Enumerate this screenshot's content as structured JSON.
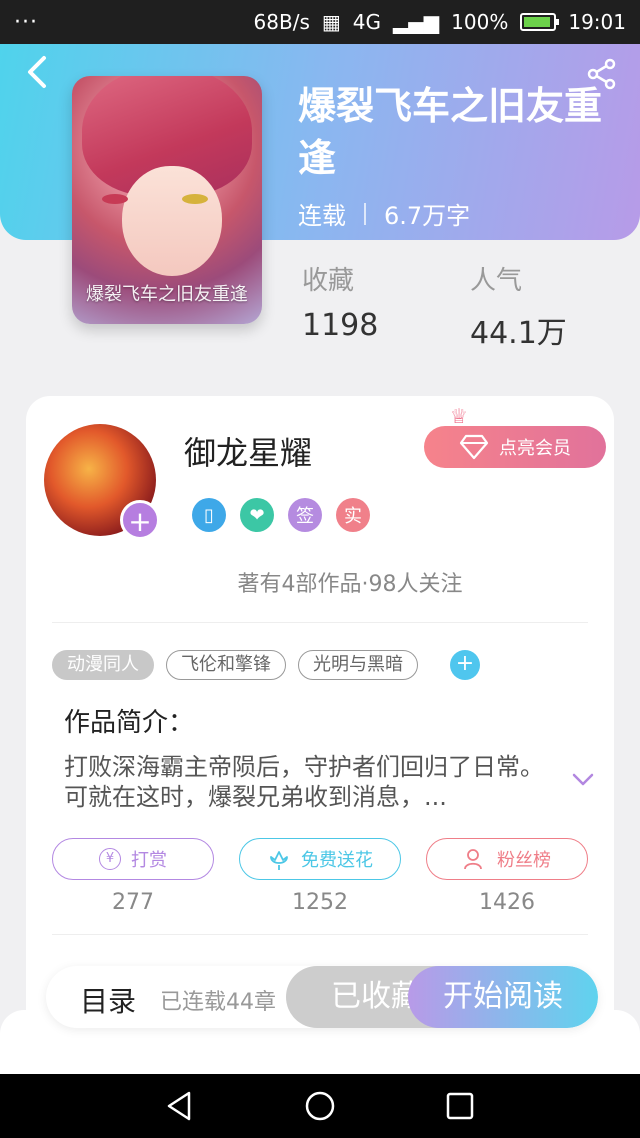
{
  "status": {
    "dots": "···",
    "speed": "68B/s",
    "network": "4G",
    "battery": "100%",
    "time": "19:01"
  },
  "book": {
    "title": "爆裂飞车之旧友重逢",
    "cover_caption": "爆裂飞车之旧友重逢",
    "status": "连载",
    "word_count": "6.7万字",
    "favorites_label": "收藏",
    "favorites_value": "1198",
    "popularity_label": "人气",
    "popularity_value": "44.1万"
  },
  "author": {
    "name": "御龙星耀",
    "vip_label": "点亮会员",
    "badges": [
      {
        "icon": "phone-icon",
        "text": "",
        "color": "#3ea8e8"
      },
      {
        "icon": "handshake-icon",
        "text": "",
        "color": "#3cc7a5"
      },
      {
        "icon": "sign-icon",
        "text": "签",
        "color": "#b58be0"
      },
      {
        "icon": "verified-icon",
        "text": "实",
        "color": "#f0808a"
      }
    ],
    "works_info": "著有4部作品·98人关注"
  },
  "tags": [
    "动漫同人",
    "飞伦和擎锋",
    "光明与黑暗"
  ],
  "intro": {
    "heading": "作品简介：",
    "text": "打败深海霸主帝陨后，守护者们回归了日常。可就在这时，爆裂兄弟收到消息，..."
  },
  "actions": [
    {
      "label": "打赏",
      "icon": "yen-icon",
      "count": "277",
      "color": "#b388e2"
    },
    {
      "label": "免费送花",
      "icon": "flower-icon",
      "count": "1252",
      "color": "#4cc7e6"
    },
    {
      "label": "粉丝榜",
      "icon": "fans-icon",
      "count": "1426",
      "color": "#ef7e88"
    }
  ],
  "bottom": {
    "toc_label": "目录",
    "toc_sub": "已连载44章",
    "collected_label": "已收藏",
    "read_label": "开始阅读"
  },
  "colors": {
    "header_start": "#4fd3ec",
    "header_end": "#b79be8",
    "accent_purple": "#b67ee0"
  }
}
